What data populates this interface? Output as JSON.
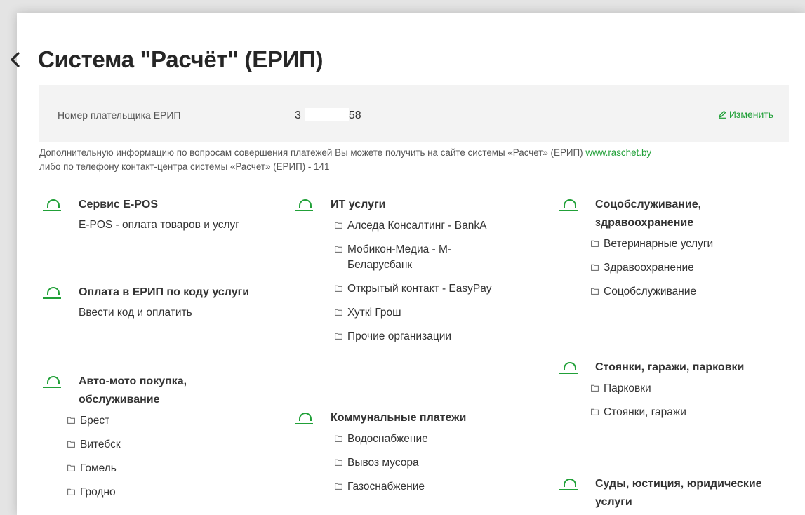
{
  "page": {
    "title": "Система \"Расчёт\" (ЕРИП)"
  },
  "payer": {
    "label": "Номер плательщика ЕРИП",
    "number_prefix": "3",
    "number_suffix": "58",
    "change_label": "Изменить"
  },
  "info": {
    "text": "Дополнительную информацию по вопросам совершения платежей Вы можете получить на сайте системы «Расчет» (ЕРИП)",
    "link": "www.raschet.by",
    "text2": "либо по телефону контакт-центра системы «Расчет» (ЕРИП) - 141"
  },
  "colors": {
    "accent": "#21a038",
    "panel": "#f3f3f3"
  },
  "icons": {
    "back": "chevron-left-icon",
    "edit": "pencil-icon",
    "group": "arc-icon",
    "folder": "folder-icon"
  },
  "groups": {
    "epos": {
      "title": "Сервис E-POS",
      "item": "E-POS - оплата товаров и услуг"
    },
    "code": {
      "title": "Оплата в ЕРИП по коду услуги",
      "item": "Ввести код и оплатить"
    },
    "auto": {
      "title": "Авто-мото покупка, обслуживание",
      "items": [
        "Брест",
        "Витебск",
        "Гомель",
        "Гродно"
      ]
    },
    "it": {
      "title": "ИТ услуги",
      "items": [
        "Алседа Консалтинг - BankA",
        "Мобикон-Медиа - М-Беларусбанк",
        "Открытый контакт - EasyPay",
        "Хуткi Грош",
        "Прочие организации"
      ]
    },
    "communal": {
      "title": "Коммунальные платежи",
      "items": [
        "Водоснабжение",
        "Вывоз мусора",
        "Газоснабжение"
      ]
    },
    "social": {
      "title": "Соцобслуживание, здравоохранение",
      "items": [
        "Ветеринарные услуги",
        "Здравоохранение",
        "Соцобслуживание"
      ]
    },
    "parking": {
      "title": "Стоянки, гаражи, парковки",
      "items": [
        "Парковки",
        "Стоянки, гаражи"
      ]
    },
    "courts": {
      "title": "Суды, юстиция, юридические услуги"
    }
  }
}
